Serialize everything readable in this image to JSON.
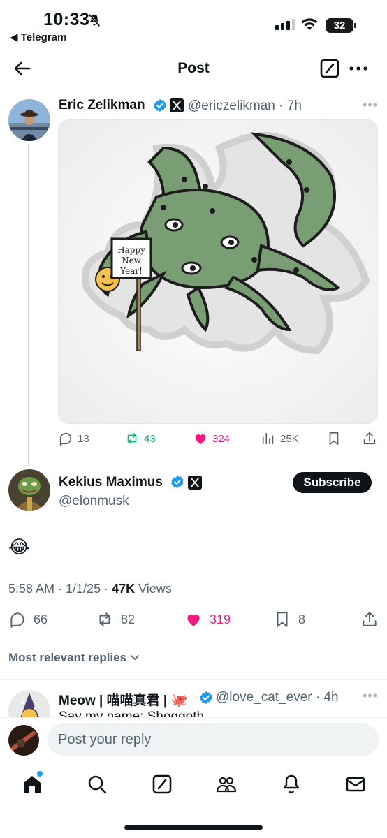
{
  "status_bar": {
    "time": "10:33",
    "back_app": "◀ Telegram",
    "battery": "32"
  },
  "header": {
    "title": "Post",
    "icons": [
      "back-arrow-icon",
      "grok-compose-icon",
      "more-dots-icon"
    ]
  },
  "quoted_post": {
    "name": "Eric Zelikman",
    "handle": "@ericzelikman",
    "time": "7h",
    "sign_text": [
      "Happy",
      "New",
      "Year!"
    ],
    "stats": {
      "replies": "13",
      "reposts": "43",
      "likes": "324",
      "views": "25K"
    }
  },
  "main_post": {
    "name": "Kekius Maximus",
    "handle": "@elonmusk",
    "subscribe_label": "Subscribe",
    "text": "😂",
    "timestamp": "5:58 AM · 1/1/25 · ",
    "views_count": "47K",
    "views_label": " Views",
    "stats": {
      "replies": "66",
      "reposts": "82",
      "likes": "319",
      "bookmarks": "8"
    }
  },
  "replies_sort": "Most relevant replies",
  "reply_post": {
    "name": "Meow | 喵喵真君 | 🐙",
    "handle": "@love_cat_ever",
    "time": "4h",
    "text": "Say my name: Shoggoth"
  },
  "reply_bar": {
    "placeholder": "Post your reply"
  },
  "colors": {
    "accent": "#1d9bf0",
    "like": "#f91880",
    "repost": "#00ba7c",
    "text_secondary": "#536471"
  }
}
